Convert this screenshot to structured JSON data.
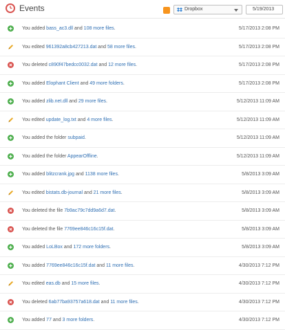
{
  "header": {
    "title": "Events",
    "dropdown_value": "Dropbox",
    "date_value": "5/19/2013"
  },
  "events": [
    {
      "type": "add",
      "pre": "You added ",
      "item": "bass_ac3.dll",
      "mid": " and ",
      "more": "108 more files",
      "end": ".",
      "time": "5/17/2013 2:08 PM"
    },
    {
      "type": "edit",
      "pre": "You edited ",
      "item": "961392a8cb427213.dat",
      "mid": " and ",
      "more": "58 more files",
      "end": ".",
      "time": "5/17/2013 2:08 PM"
    },
    {
      "type": "del",
      "pre": "You deleted ",
      "item": "c890f47bedcc0032.dat",
      "mid": " and ",
      "more": "12 more files",
      "end": ".",
      "time": "5/17/2013 2:08 PM"
    },
    {
      "type": "add",
      "pre": "You added ",
      "item": "Elophant Client",
      "mid": " and ",
      "more": "49 more folders",
      "end": ".",
      "time": "5/17/2013 2:08 PM"
    },
    {
      "type": "add",
      "pre": "You added ",
      "item": "zlib.net.dll",
      "mid": " and ",
      "more": "29 more files",
      "end": ".",
      "time": "5/12/2013 11:09 AM"
    },
    {
      "type": "edit",
      "pre": "You edited ",
      "item": "update_log.txt",
      "mid": " and ",
      "more": "4 more files",
      "end": ".",
      "time": "5/12/2013 11:09 AM"
    },
    {
      "type": "add",
      "pre": "You added the folder ",
      "item": "subpaid",
      "mid": "",
      "more": "",
      "end": ".",
      "time": "5/12/2013 11:09 AM"
    },
    {
      "type": "add",
      "pre": "You added the folder ",
      "item": "AppearOffline",
      "mid": "",
      "more": "",
      "end": ".",
      "time": "5/12/2013 11:09 AM"
    },
    {
      "type": "add",
      "pre": "You added ",
      "item": "blitzcrank.jpg",
      "mid": " and ",
      "more": "1138 more files",
      "end": ".",
      "time": "5/8/2013 3:09 AM"
    },
    {
      "type": "edit",
      "pre": "You edited ",
      "item": "bistats.db-journal",
      "mid": " and ",
      "more": "21 more files",
      "end": ".",
      "time": "5/8/2013 3:09 AM"
    },
    {
      "type": "del",
      "pre": "You deleted the file ",
      "item": "7b9ac79c7dd9a6d7.dat",
      "mid": "",
      "more": "",
      "end": ".",
      "time": "5/8/2013 3:09 AM"
    },
    {
      "type": "del",
      "pre": "You deleted the file ",
      "item": "7769ee846c16c15f.dat",
      "mid": "",
      "more": "",
      "end": ".",
      "time": "5/8/2013 3:09 AM"
    },
    {
      "type": "add",
      "pre": "You added ",
      "item": "LoLBox",
      "mid": " and ",
      "more": "172 more folders",
      "end": ".",
      "time": "5/8/2013 3:09 AM"
    },
    {
      "type": "add",
      "pre": "You added ",
      "item": "7769ee846c16c15f.dat",
      "mid": " and ",
      "more": "11 more files",
      "end": ".",
      "time": "4/30/2013 7:12 PM"
    },
    {
      "type": "edit",
      "pre": "You edited ",
      "item": "eas.db",
      "mid": " and ",
      "more": "15 more files",
      "end": ".",
      "time": "4/30/2013 7:12 PM"
    },
    {
      "type": "del",
      "pre": "You deleted ",
      "item": "6ab77ba93757a618.dat",
      "mid": " and ",
      "more": "11 more files",
      "end": ".",
      "time": "4/30/2013 7:12 PM"
    },
    {
      "type": "add",
      "pre": "You added ",
      "item": "77",
      "mid": " and ",
      "more": "3 more folders",
      "end": ".",
      "time": "4/30/2013 7:12 PM"
    }
  ]
}
